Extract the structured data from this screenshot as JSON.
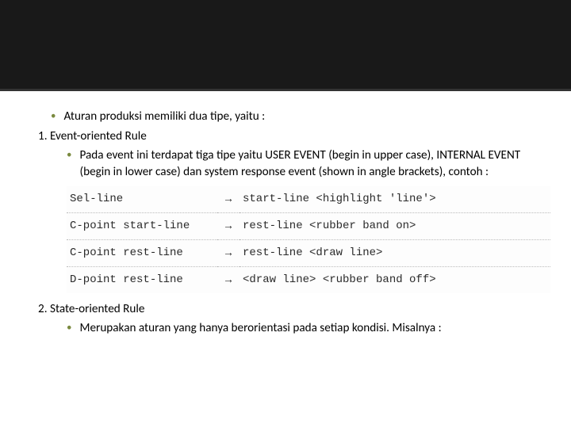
{
  "bullets": {
    "intro": "Aturan produksi memiliki dua tipe, yaitu :",
    "item1_title": "1. Event-oriented Rule",
    "item1_desc": "Pada event ini terdapat tiga tipe yaitu USER EVENT (begin in upper case), INTERNAL EVENT (begin in lower case) dan system response event (shown in angle brackets), contoh :",
    "item2_title": "2. State-oriented Rule",
    "item2_desc": "Merupakan aturan yang hanya berorientasi pada setiap kondisi. Misalnya :"
  },
  "rules": [
    {
      "lhs": "Sel-line",
      "arrow": "→",
      "rhs": "start-line <highlight 'line'>"
    },
    {
      "lhs": "C-point start-line",
      "arrow": "→",
      "rhs": "rest-line <rubber band on>"
    },
    {
      "lhs": "C-point rest-line",
      "arrow": "→",
      "rhs": "rest-line <draw line>"
    },
    {
      "lhs": "D-point rest-line",
      "arrow": "→",
      "rhs": "<draw line> <rubber band off>"
    }
  ]
}
